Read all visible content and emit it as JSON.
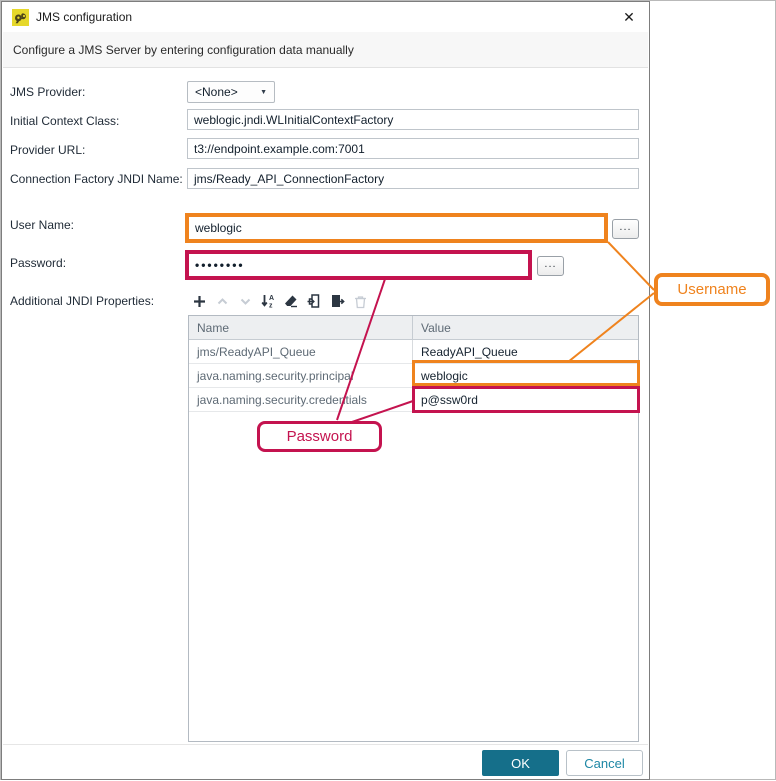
{
  "dialog": {
    "title": "JMS configuration",
    "close_icon": "✕",
    "subtitle": "Configure a JMS Server by entering configuration data manually",
    "fields": {
      "jms_provider": {
        "label": "JMS Provider:",
        "value": "<None>",
        "dropdown_icon": "▼"
      },
      "initial_context_class": {
        "label": "Initial Context Class:",
        "value": "weblogic.jndi.WLInitialContextFactory"
      },
      "provider_url": {
        "label": "Provider URL:",
        "value": "t3://endpoint.example.com:7001"
      },
      "connection_factory": {
        "label": "Connection Factory JNDI Name:",
        "value": "jms/Ready_API_ConnectionFactory"
      },
      "user_name": {
        "label": "User Name:",
        "value": "weblogic",
        "browse_label": "..."
      },
      "password": {
        "label": "Password:",
        "value": "••••••••",
        "browse_label": "..."
      }
    },
    "properties": {
      "label": "Additional JNDI Properties:",
      "toolbar_icons": [
        {
          "name": "add-icon",
          "enabled": true
        },
        {
          "name": "move-up-icon",
          "enabled": false
        },
        {
          "name": "move-down-icon",
          "enabled": false
        },
        {
          "name": "sort-icon",
          "enabled": true
        },
        {
          "name": "clear-icon",
          "enabled": true
        },
        {
          "name": "import-icon",
          "enabled": true
        },
        {
          "name": "export-icon",
          "enabled": true
        },
        {
          "name": "delete-icon",
          "enabled": false
        }
      ],
      "table": {
        "columns": {
          "name": "Name",
          "value": "Value"
        },
        "rows": [
          {
            "name": "jms/ReadyAPI_Queue",
            "value": "ReadyAPI_Queue",
            "highlight": "none"
          },
          {
            "name": "java.naming.security.principal",
            "value": "weblogic",
            "highlight": "orange"
          },
          {
            "name": "java.naming.security.credentials",
            "value": "p@ssw0rd",
            "highlight": "crimson"
          }
        ]
      }
    },
    "footer": {
      "ok_label": "OK",
      "cancel_label": "Cancel"
    }
  },
  "annotations": {
    "username_callout": "Username",
    "password_callout": "Password",
    "colors": {
      "username_highlight": "#ef831e",
      "password_highlight": "#c4134f"
    }
  },
  "colors": {
    "ok_button": "#156f8a",
    "cancel_text": "#1d87a5",
    "table_header_bg": "#edeff1"
  }
}
